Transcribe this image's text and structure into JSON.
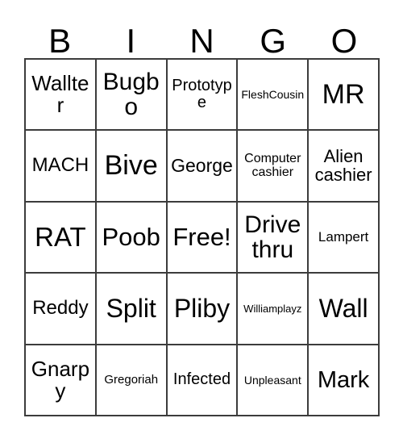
{
  "card": {
    "title": "BINGO",
    "header_letters": [
      "B",
      "I",
      "N",
      "G",
      "O"
    ],
    "colors": {
      "background": "#ffffff",
      "grid_line": "#3c3c3c",
      "text": "#000000"
    },
    "grid": {
      "columns": 5,
      "rows": 5,
      "free_space_label": "Free!",
      "free_space_position": "center"
    },
    "cells": [
      {
        "text": "Wallter",
        "size": "fs-26",
        "row": 1,
        "col": 1
      },
      {
        "text": "Bugbo",
        "size": "fs-30",
        "row": 1,
        "col": 2
      },
      {
        "text": "Prototype",
        "size": "fs-20",
        "row": 1,
        "col": 3
      },
      {
        "text": "FleshCousin",
        "size": "fs-14",
        "row": 1,
        "col": 4
      },
      {
        "text": "MR",
        "size": "fs-34",
        "row": 1,
        "col": 5
      },
      {
        "text": "MACH",
        "size": "fs-24",
        "row": 2,
        "col": 1
      },
      {
        "text": "Bive",
        "size": "fs-34",
        "row": 2,
        "col": 2
      },
      {
        "text": "George",
        "size": "fs-23",
        "row": 2,
        "col": 3
      },
      {
        "text": "Computer cashier",
        "size": "fs-16",
        "row": 2,
        "col": 4
      },
      {
        "text": "Alien cashier",
        "size": "fs-22",
        "row": 2,
        "col": 5
      },
      {
        "text": "RAT",
        "size": "fs-33",
        "row": 3,
        "col": 1
      },
      {
        "text": "Poob",
        "size": "fs-31",
        "row": 3,
        "col": 2
      },
      {
        "text": "Free!",
        "size": "fs-31",
        "row": 3,
        "col": 3
      },
      {
        "text": "Drive thru",
        "size": "fs-30",
        "row": 3,
        "col": 4
      },
      {
        "text": "Lampert",
        "size": "fs-17",
        "row": 3,
        "col": 5
      },
      {
        "text": "Reddy",
        "size": "fs-24",
        "row": 4,
        "col": 1
      },
      {
        "text": "Split",
        "size": "fs-32",
        "row": 4,
        "col": 2
      },
      {
        "text": "Pliby",
        "size": "fs-32",
        "row": 4,
        "col": 3
      },
      {
        "text": "Williamplayz",
        "size": "fs-13",
        "row": 4,
        "col": 4
      },
      {
        "text": "Wall",
        "size": "fs-32",
        "row": 4,
        "col": 5
      },
      {
        "text": "Gnarpy",
        "size": "fs-26",
        "row": 5,
        "col": 1
      },
      {
        "text": "Gregoriah",
        "size": "fs-15",
        "row": 5,
        "col": 2
      },
      {
        "text": "Infected",
        "size": "fs-20",
        "row": 5,
        "col": 3
      },
      {
        "text": "Unpleasant",
        "size": "fs-14",
        "row": 5,
        "col": 4
      },
      {
        "text": "Mark",
        "size": "fs-29",
        "row": 5,
        "col": 5
      }
    ]
  }
}
